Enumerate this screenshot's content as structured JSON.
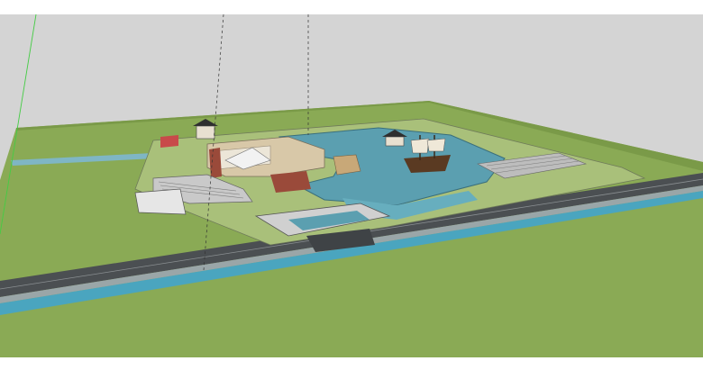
{
  "app": {
    "view": "sketchup-3d-viewport"
  },
  "colors": {
    "sky": "#d4d4d4",
    "grass": "#8aaa55",
    "water": "#5b9fb0",
    "road": "#555a5c",
    "paving": "#d8c8a8",
    "brick": "#9a4a3a",
    "axis_green": "#44cc44"
  },
  "watermark": {
    "text": ""
  }
}
